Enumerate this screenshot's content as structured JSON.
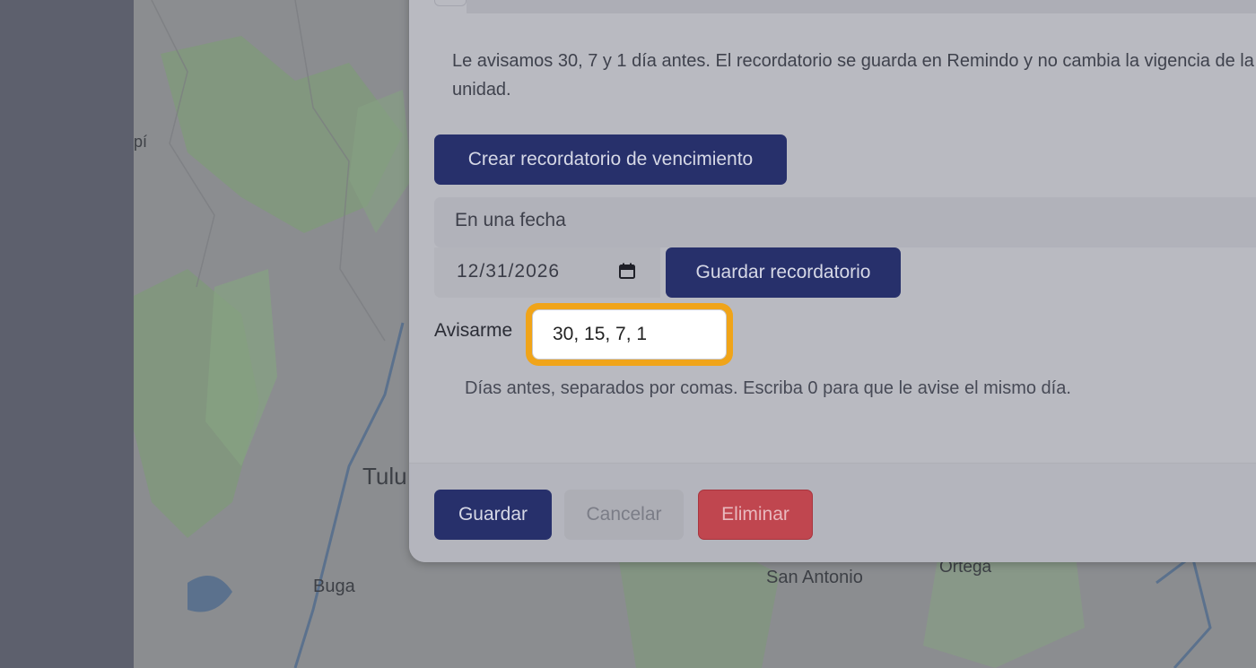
{
  "map": {
    "labels": [
      "pí",
      "Tulu",
      "Buga",
      "San Antonio",
      "Ortega"
    ]
  },
  "dialog": {
    "info_text": "Le avisamos 30, 7 y 1 día antes. El recordatorio se guarda en Remindo y no cambia la vigencia de la unidad.",
    "create_button": "Crear recordatorio de vencimiento",
    "section_label": "En una fecha",
    "date_value": "12/31/2026",
    "save_reminder_button": "Guardar recordatorio",
    "avisarme_label": "Avisarme",
    "days_value": "30, 15, 7, 1",
    "help_text": "Días antes, separados por comas. Escriba 0 para que le avise el mismo día."
  },
  "footer": {
    "save": "Guardar",
    "cancel": "Cancelar",
    "delete": "Eliminar"
  },
  "colors": {
    "primary": "#27306b",
    "danger": "#c0464f",
    "focus_ring": "#f0a419"
  }
}
